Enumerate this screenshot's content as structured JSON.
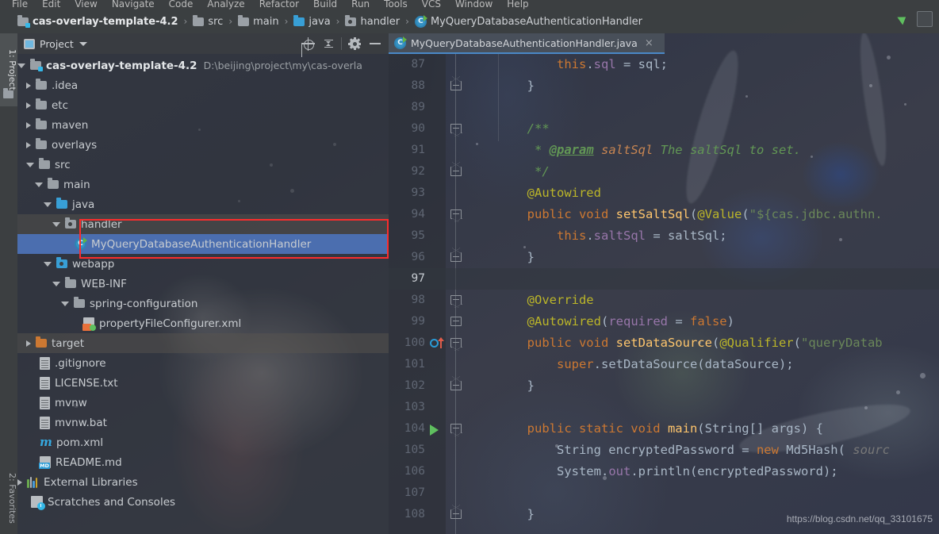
{
  "menu": {
    "items": [
      "File",
      "Edit",
      "View",
      "Navigate",
      "Code",
      "Analyze",
      "Refactor",
      "Build",
      "Run",
      "Tools",
      "VCS",
      "Window",
      "Help"
    ]
  },
  "breadcrumb": {
    "separator": "›",
    "items": [
      {
        "label": "cas-overlay-template-4.2",
        "icon": "folder-module-icon"
      },
      {
        "label": "src",
        "icon": "folder-icon"
      },
      {
        "label": "main",
        "icon": "folder-icon"
      },
      {
        "label": "java",
        "icon": "folder-source-icon"
      },
      {
        "label": "handler",
        "icon": "folder-package-icon"
      },
      {
        "label": "MyQueryDatabaseAuthenticationHandler",
        "icon": "java-class-icon"
      }
    ]
  },
  "toolstrip": {
    "project_label": "1: Project",
    "favorites_label": "2: Favorites"
  },
  "project_panel": {
    "title": "Project",
    "tools": [
      {
        "name": "locate-icon",
        "label": "Select Opened File"
      },
      {
        "name": "collapse-all-icon",
        "label": "Collapse All"
      },
      {
        "name": "gear-icon",
        "label": "Settings"
      },
      {
        "name": "minimize-icon",
        "label": "Hide"
      }
    ],
    "tree": [
      {
        "depth": 0,
        "twisty": "open",
        "icon": "folder-module-icon",
        "label": "cas-overlay-template-4.2",
        "bold": true,
        "sub": "D:\\beijing\\project\\my\\cas-overla"
      },
      {
        "depth": 1,
        "twisty": "closed",
        "icon": "folder-icon",
        "label": ".idea"
      },
      {
        "depth": 1,
        "twisty": "closed",
        "icon": "folder-icon",
        "label": "etc"
      },
      {
        "depth": 1,
        "twisty": "closed",
        "icon": "folder-icon",
        "label": "maven"
      },
      {
        "depth": 1,
        "twisty": "closed",
        "icon": "folder-icon",
        "label": "overlays"
      },
      {
        "depth": 1,
        "twisty": "open",
        "icon": "folder-icon",
        "label": "src"
      },
      {
        "depth": 2,
        "twisty": "open",
        "icon": "folder-icon",
        "label": "main"
      },
      {
        "depth": 3,
        "twisty": "open",
        "icon": "folder-source-icon",
        "label": "java"
      },
      {
        "depth": 4,
        "twisty": "open",
        "icon": "folder-package-icon",
        "label": "handler",
        "highlighted": true
      },
      {
        "depth": 5,
        "twisty": "none",
        "icon": "java-class-icon",
        "label": "MyQueryDatabaseAuthenticationHandler",
        "selected": true
      },
      {
        "depth": 3,
        "twisty": "open",
        "icon": "folder-webapp-icon",
        "label": "webapp"
      },
      {
        "depth": 4,
        "twisty": "open",
        "icon": "folder-icon",
        "label": "WEB-INF"
      },
      {
        "depth": 5,
        "twisty": "open",
        "icon": "folder-icon",
        "label": "spring-configuration"
      },
      {
        "depth": 6,
        "twisty": "none",
        "icon": "xml-file-icon",
        "label": "propertyFileConfigurer.xml"
      },
      {
        "depth": 1,
        "twisty": "closed",
        "icon": "folder-target-icon",
        "label": "target",
        "highlighted": true
      },
      {
        "depth": 1,
        "twisty": "none",
        "icon": "file-icon",
        "label": ".gitignore"
      },
      {
        "depth": 1,
        "twisty": "none",
        "icon": "file-icon",
        "label": "LICENSE.txt"
      },
      {
        "depth": 1,
        "twisty": "none",
        "icon": "file-icon",
        "label": "mvnw"
      },
      {
        "depth": 1,
        "twisty": "none",
        "icon": "file-icon",
        "label": "mvnw.bat"
      },
      {
        "depth": 1,
        "twisty": "none",
        "icon": "maven-file-icon",
        "label": "pom.xml"
      },
      {
        "depth": 1,
        "twisty": "none",
        "icon": "markdown-file-icon",
        "label": "README.md"
      },
      {
        "depth": 0,
        "twisty": "closed",
        "icon": "libraries-icon",
        "label": "External Libraries"
      },
      {
        "depth": 0,
        "twisty": "none",
        "icon": "scratches-icon",
        "label": "Scratches and Consoles"
      }
    ]
  },
  "editor": {
    "tab": {
      "label": "MyQueryDatabaseAuthenticationHandler.java",
      "close": "×",
      "icon": "java-class-icon"
    },
    "lines": [
      {
        "num": "87",
        "gutter": null,
        "fold": null,
        "current": false,
        "tokens": [
          {
            "t": "            ",
            "c": "pln"
          },
          {
            "t": "this",
            "c": "kw"
          },
          {
            "t": ".",
            "c": "pln"
          },
          {
            "t": "sql",
            "c": "fld"
          },
          {
            "t": " = sql;",
            "c": "pln"
          }
        ]
      },
      {
        "num": "88",
        "gutter": null,
        "fold": "end",
        "current": false,
        "tokens": [
          {
            "t": "        }",
            "c": "pln"
          }
        ]
      },
      {
        "num": "89",
        "gutter": null,
        "fold": null,
        "current": false,
        "tokens": []
      },
      {
        "num": "90",
        "gutter": null,
        "fold": "start",
        "current": false,
        "tokens": [
          {
            "t": "        /**",
            "c": "cmt"
          }
        ]
      },
      {
        "num": "91",
        "gutter": null,
        "fold": null,
        "current": false,
        "tokens": [
          {
            "t": "         * ",
            "c": "cmt"
          },
          {
            "t": "@param",
            "c": "cmt-tag"
          },
          {
            "t": " saltSql",
            "c": "param-doc"
          },
          {
            "t": " The saltSql to set.",
            "c": "cmt"
          }
        ]
      },
      {
        "num": "92",
        "gutter": null,
        "fold": "end",
        "current": false,
        "tokens": [
          {
            "t": "         */",
            "c": "cmt"
          }
        ]
      },
      {
        "num": "93",
        "gutter": null,
        "fold": null,
        "current": false,
        "tokens": [
          {
            "t": "        @Autowired",
            "c": "anno"
          }
        ]
      },
      {
        "num": "94",
        "gutter": null,
        "fold": "start",
        "current": false,
        "tokens": [
          {
            "t": "        ",
            "c": "pln"
          },
          {
            "t": "public void ",
            "c": "kw"
          },
          {
            "t": "setSaltSql",
            "c": "mth"
          },
          {
            "t": "(",
            "c": "pln"
          },
          {
            "t": "@Value",
            "c": "anno"
          },
          {
            "t": "(",
            "c": "pln"
          },
          {
            "t": "\"${cas.jdbc.authn.",
            "c": "str"
          }
        ]
      },
      {
        "num": "95",
        "gutter": null,
        "fold": null,
        "current": false,
        "tokens": [
          {
            "t": "            ",
            "c": "pln"
          },
          {
            "t": "this",
            "c": "kw"
          },
          {
            "t": ".",
            "c": "pln"
          },
          {
            "t": "saltSql",
            "c": "fld"
          },
          {
            "t": " = saltSql;",
            "c": "pln"
          }
        ]
      },
      {
        "num": "96",
        "gutter": null,
        "fold": "end",
        "current": false,
        "tokens": [
          {
            "t": "        }",
            "c": "pln"
          }
        ]
      },
      {
        "num": "97",
        "gutter": null,
        "fold": null,
        "current": true,
        "tokens": []
      },
      {
        "num": "98",
        "gutter": null,
        "fold": "start",
        "current": false,
        "tokens": [
          {
            "t": "        @Override",
            "c": "anno"
          }
        ]
      },
      {
        "num": "99",
        "gutter": null,
        "fold": "mid",
        "current": false,
        "tokens": [
          {
            "t": "        @Autowired",
            "c": "anno"
          },
          {
            "t": "(",
            "c": "pln"
          },
          {
            "t": "required",
            "c": "fld"
          },
          {
            "t": " = ",
            "c": "pln"
          },
          {
            "t": "false",
            "c": "kw"
          },
          {
            "t": ")",
            "c": "pln"
          }
        ]
      },
      {
        "num": "100",
        "gutter": "override-icon",
        "fold": "start",
        "current": false,
        "tokens": [
          {
            "t": "        ",
            "c": "pln"
          },
          {
            "t": "public void ",
            "c": "kw"
          },
          {
            "t": "setDataSource",
            "c": "mth"
          },
          {
            "t": "(",
            "c": "pln"
          },
          {
            "t": "@Qualifier",
            "c": "anno"
          },
          {
            "t": "(",
            "c": "pln"
          },
          {
            "t": "\"queryDatab",
            "c": "str"
          }
        ]
      },
      {
        "num": "101",
        "gutter": null,
        "fold": null,
        "current": false,
        "tokens": [
          {
            "t": "            ",
            "c": "pln"
          },
          {
            "t": "super",
            "c": "kw"
          },
          {
            "t": ".setDataSource(dataSource);",
            "c": "pln"
          }
        ]
      },
      {
        "num": "102",
        "gutter": null,
        "fold": "end",
        "current": false,
        "tokens": [
          {
            "t": "        }",
            "c": "pln"
          }
        ]
      },
      {
        "num": "103",
        "gutter": null,
        "fold": null,
        "current": false,
        "tokens": []
      },
      {
        "num": "104",
        "gutter": "run-icon",
        "fold": "start",
        "current": false,
        "tokens": [
          {
            "t": "        ",
            "c": "pln"
          },
          {
            "t": "public static void ",
            "c": "kw"
          },
          {
            "t": "main",
            "c": "mth"
          },
          {
            "t": "(String[] args) {",
            "c": "pln"
          }
        ]
      },
      {
        "num": "105",
        "gutter": null,
        "fold": null,
        "current": false,
        "tokens": [
          {
            "t": "            String encryptedPassword = ",
            "c": "pln"
          },
          {
            "t": "new ",
            "c": "kw"
          },
          {
            "t": "Md5Hash( ",
            "c": "pln"
          },
          {
            "t": "sourc",
            "c": "hint"
          }
        ]
      },
      {
        "num": "106",
        "gutter": null,
        "fold": null,
        "current": false,
        "tokens": [
          {
            "t": "            System.",
            "c": "pln"
          },
          {
            "t": "out",
            "c": "fld"
          },
          {
            "t": ".println(encryptedPassword);",
            "c": "pln"
          }
        ]
      },
      {
        "num": "107",
        "gutter": null,
        "fold": null,
        "current": false,
        "tokens": []
      },
      {
        "num": "108",
        "gutter": null,
        "fold": "end",
        "current": false,
        "tokens": [
          {
            "t": "        }",
            "c": "pln"
          }
        ]
      }
    ]
  },
  "watermark": "https://blog.csdn.net/qq_33101675",
  "colors": {
    "selection": "#4b6eaf",
    "highlight_box": "#fa2d2d",
    "accent": "#3592c4",
    "tab_underline": "#4a88c7"
  }
}
